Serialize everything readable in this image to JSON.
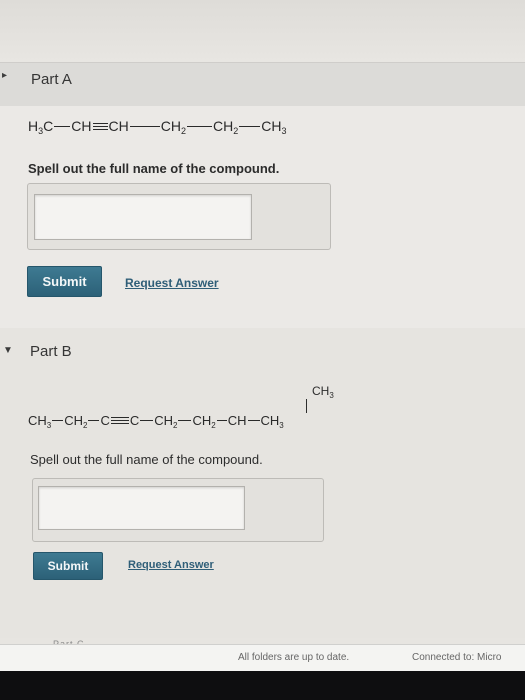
{
  "partA": {
    "toggle_icon": "chevron-right-icon",
    "title": "Part A",
    "formula": {
      "g1": "H",
      "g1sub": "3",
      "g1b": "C",
      "g2": "CH",
      "g3": "CH",
      "g4": "CH",
      "g4sub": "2",
      "g5": "CH",
      "g5sub": "2",
      "g6": "CH",
      "g6sub": "3"
    },
    "prompt": "Spell out the full name of the compound.",
    "answer_value": "",
    "submit_label": "Submit",
    "request_label": "Request Answer"
  },
  "partB": {
    "toggle_icon": "triangle-down-icon",
    "title": "Part B",
    "branch": {
      "text": "CH",
      "sub": "3"
    },
    "formula": {
      "g1": "CH",
      "g1sub": "3",
      "g2": "CH",
      "g2sub": "2",
      "g3": "C",
      "g4": "C",
      "g5": "CH",
      "g5sub": "2",
      "g6": "CH",
      "g6sub": "2",
      "g7": "CH",
      "g8": "CH",
      "g8sub": "3"
    },
    "prompt": "Spell out the full name of the compound.",
    "answer_value": "",
    "submit_label": "Submit",
    "request_label": "Request Answer"
  },
  "partC_hint": "Part C",
  "status_bar": {
    "folders": "All folders are up to date.",
    "connected": "Connected to: Micro"
  },
  "colors": {
    "submit_bg": "#2f657c",
    "link": "#2f5e78"
  }
}
